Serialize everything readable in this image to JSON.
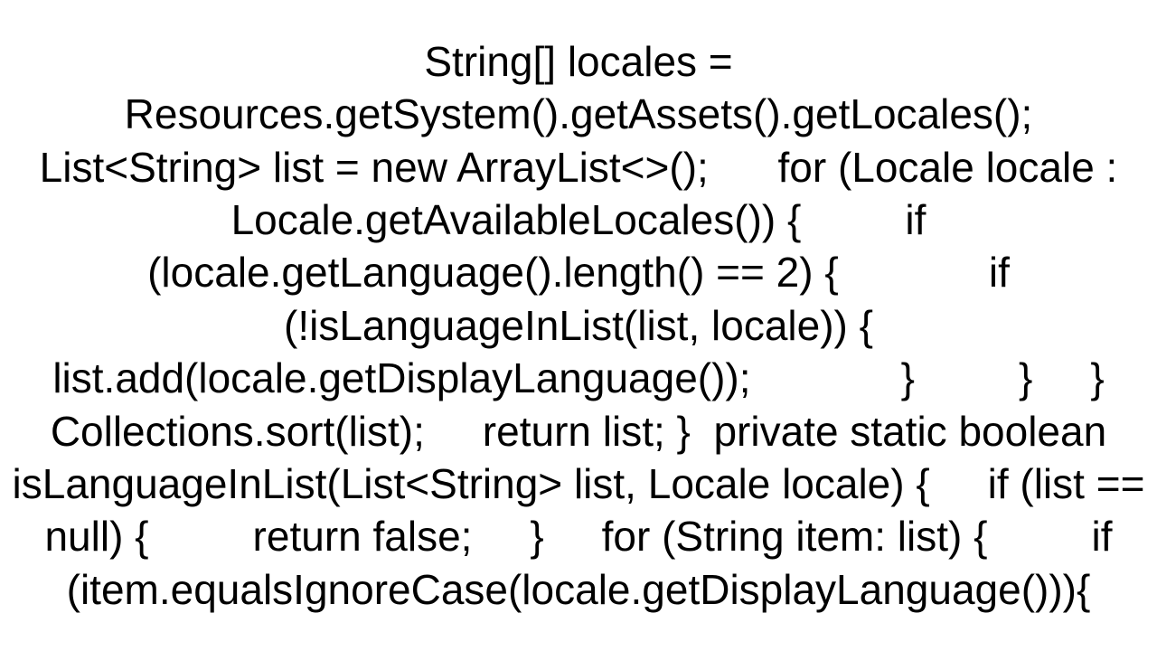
{
  "code_text": "String[] locales = Resources.getSystem().getAssets().getLocales();     List<String> list = new ArrayList<>();      for (Locale locale : Locale.getAvailableLocales()) {         if (locale.getLanguage().length() == 2) {             if (!isLanguageInList(list, locale)) {                 list.add(locale.getDisplayLanguage());             }         }     }      Collections.sort(list);     return list; }  private static boolean isLanguageInList(List<String> list, Locale locale) {     if (list == null) {         return false;     }     for (String item: list) {         if (item.equalsIgnoreCase(locale.getDisplayLanguage())){"
}
